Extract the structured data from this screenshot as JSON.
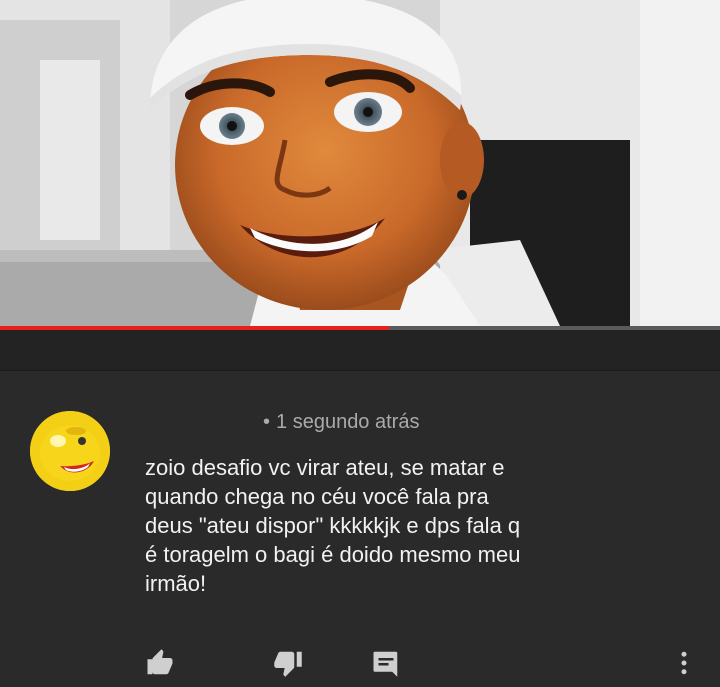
{
  "video": {
    "progress_fraction": 0.54
  },
  "comment": {
    "timestamp": "1 segundo atrás",
    "lines": [
      "zoio desafio vc virar ateu, se matar e",
      "quando chega no céu você fala pra",
      "deus \"ateu dispor\" kkkkkjk e dps fala q",
      "é toragelm o bagi é doido mesmo meu",
      "irmão!"
    ]
  },
  "actions": {
    "icons": [
      "thumbs-up-icon",
      "thumbs-down-icon",
      "reply-icon",
      "more-vert-icon"
    ]
  },
  "colors": {
    "background": "#2a2a2a",
    "progress": "#e8201b",
    "text": "#f1f1f1",
    "meta": "#aaaaaa",
    "icon": "#cfcfcf"
  }
}
